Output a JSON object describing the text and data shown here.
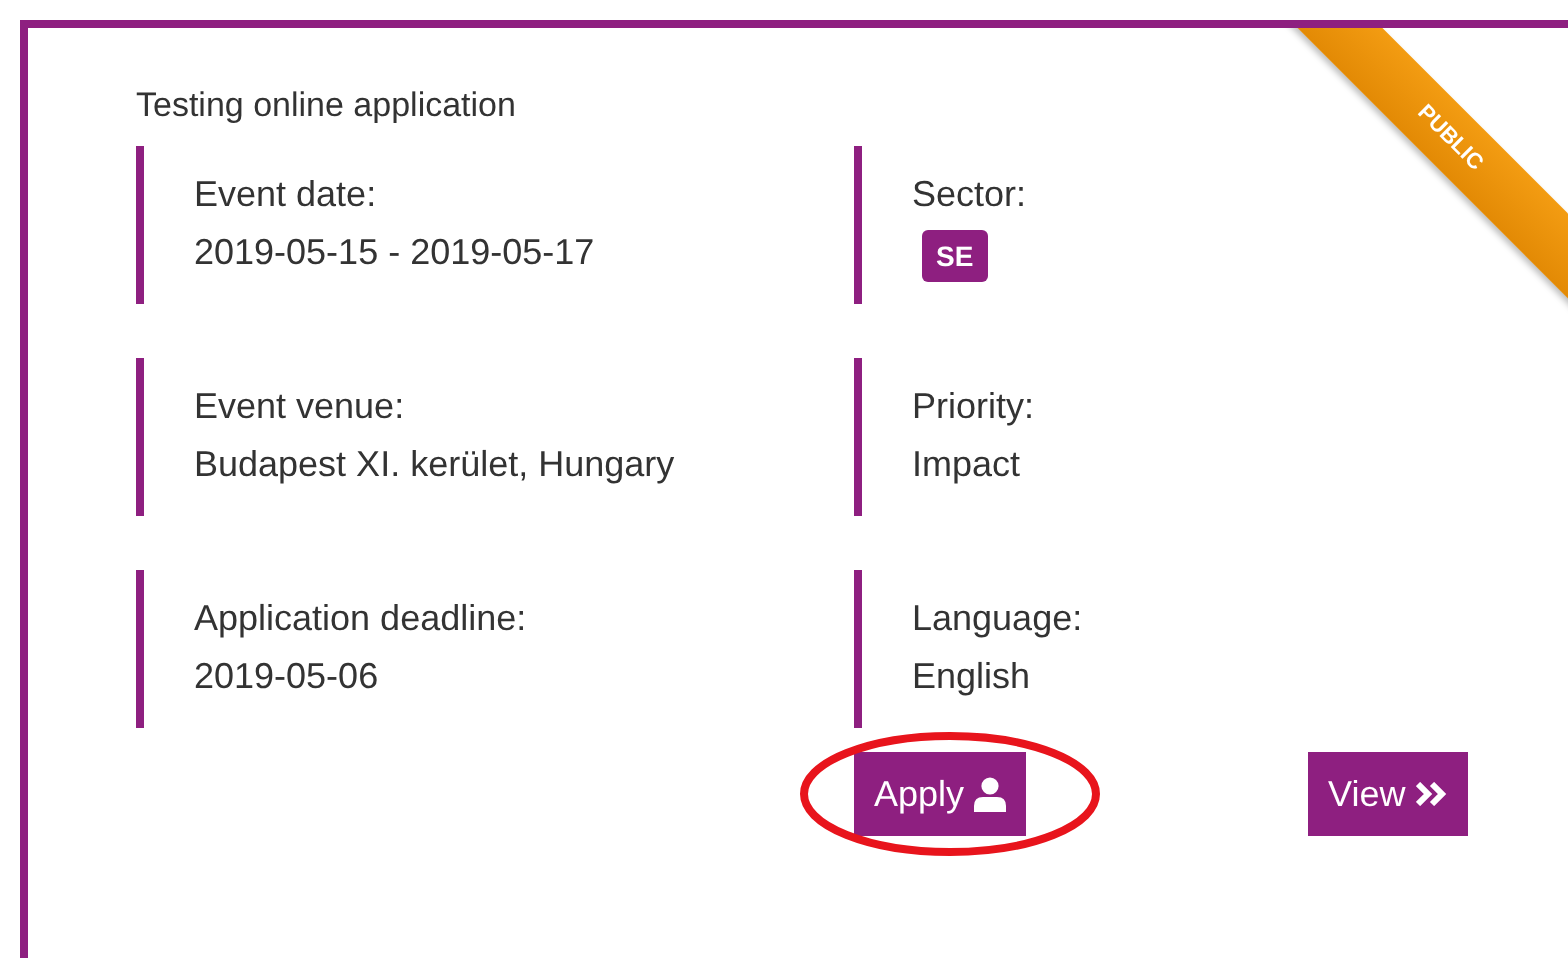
{
  "card": {
    "title": "Testing online application",
    "ribbon": "PUBLIC",
    "fields": [
      {
        "label": "Event date:",
        "value": "2019-05-15 - 2019-05-17",
        "kind": "text"
      },
      {
        "label": "Sector:",
        "value": "SE",
        "kind": "badge"
      },
      {
        "label": "Event venue:",
        "value": "Budapest XI. kerület, Hungary",
        "kind": "text"
      },
      {
        "label": "Priority:",
        "value": "Impact",
        "kind": "text"
      },
      {
        "label": "Application deadline:",
        "value": "2019-05-06",
        "kind": "text"
      },
      {
        "label": "Language:",
        "value": "English",
        "kind": "text"
      }
    ],
    "buttons": [
      {
        "label": "Apply",
        "kind": "apply",
        "highlighted": true
      },
      {
        "label": "View",
        "kind": "view",
        "highlighted": false
      }
    ]
  }
}
